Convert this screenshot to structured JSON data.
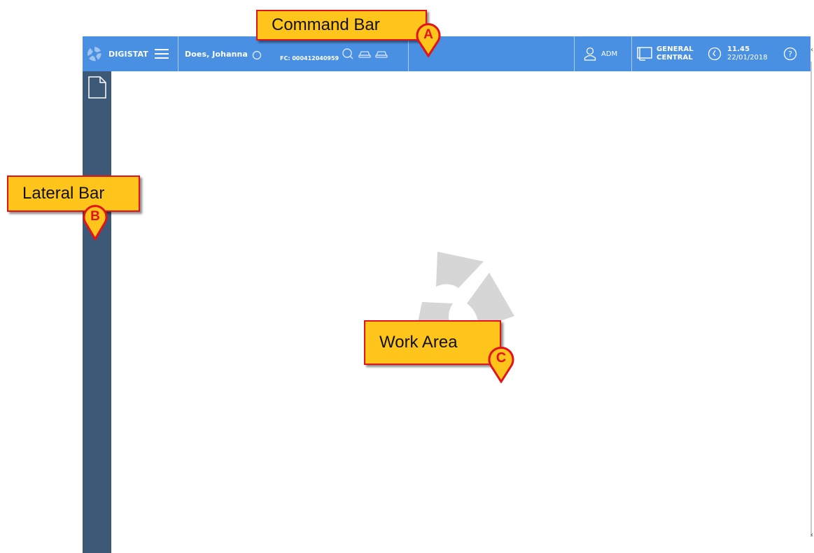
{
  "command_bar": {
    "brand": "DIGISTAT",
    "patient_name": "Does, Johanna",
    "patient_code": "FC: 000412040959",
    "user": "ADM",
    "workstation_line1": "GENERAL",
    "workstation_line2": "CENTRAL",
    "time": "11.45",
    "date": "22/01/2018"
  },
  "callouts": {
    "command_bar": {
      "text": "Command Bar",
      "marker": "A"
    },
    "lateral_bar": {
      "text": "Lateral Bar",
      "marker": "B"
    },
    "work_area": {
      "text": "Work Area",
      "marker": "C"
    }
  },
  "colors": {
    "command_bar_bg": "#4a90e2",
    "lateral_bar_bg": "#3c5a77",
    "callout_fill": "#ffc51a",
    "callout_border": "#e3121b"
  },
  "icons": [
    "digistat-logo-icon",
    "menu-icon",
    "patient-status-icon",
    "search-icon",
    "car-icon",
    "user-icon",
    "workstation-icon",
    "clock-icon",
    "help-icon",
    "document-icon",
    "digistat-watermark-icon"
  ]
}
